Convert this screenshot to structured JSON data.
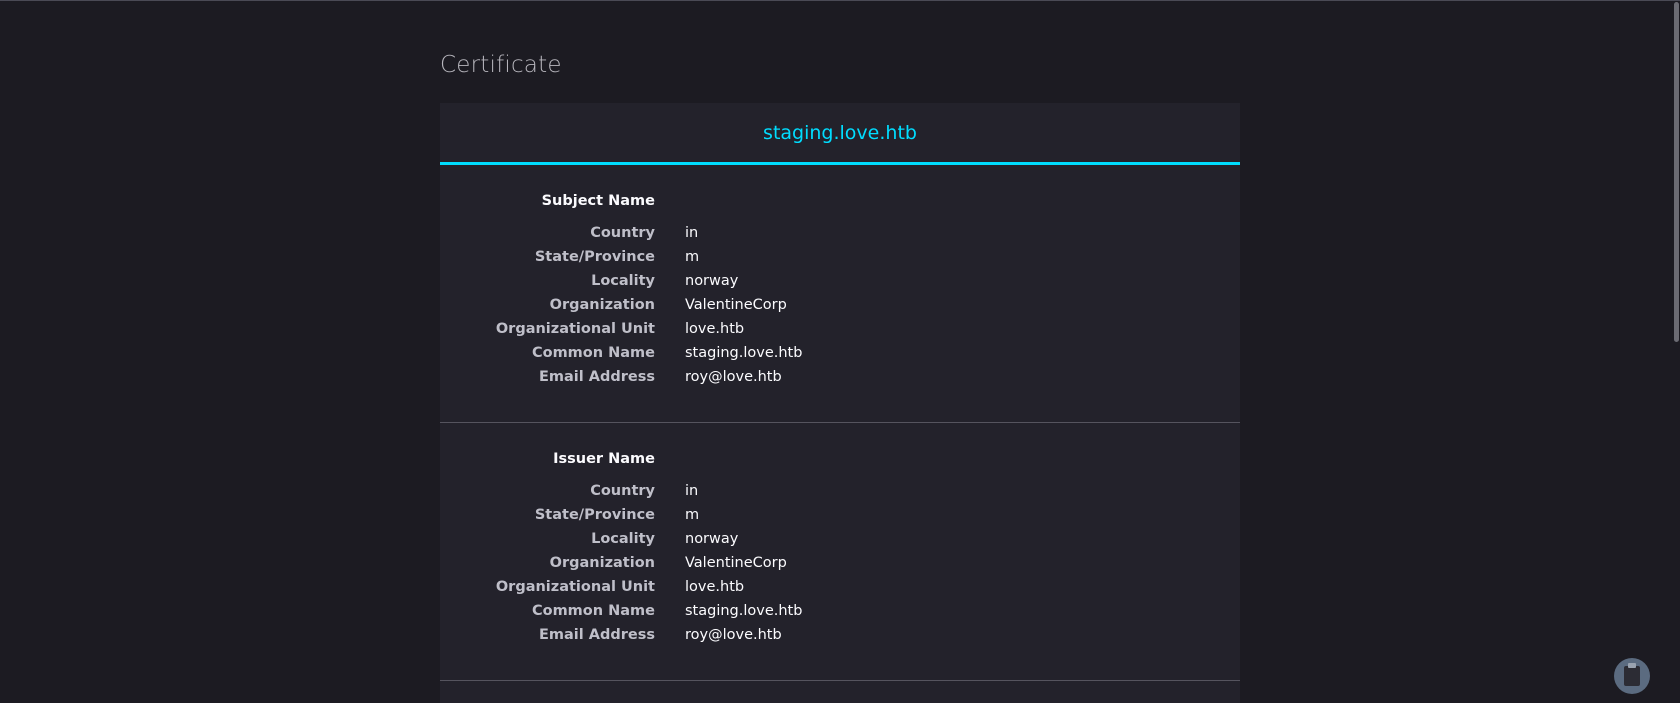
{
  "page": {
    "title": "Certificate"
  },
  "certificate": {
    "tab_title": "staging.love.htb",
    "subject": {
      "heading": "Subject Name",
      "fields": [
        {
          "label": "Country",
          "value": "in"
        },
        {
          "label": "State/Province",
          "value": "m"
        },
        {
          "label": "Locality",
          "value": "norway"
        },
        {
          "label": "Organization",
          "value": "ValentineCorp"
        },
        {
          "label": "Organizational Unit",
          "value": "love.htb"
        },
        {
          "label": "Common Name",
          "value": "staging.love.htb"
        },
        {
          "label": "Email Address",
          "value": "roy@love.htb"
        }
      ]
    },
    "issuer": {
      "heading": "Issuer Name",
      "fields": [
        {
          "label": "Country",
          "value": "in"
        },
        {
          "label": "State/Province",
          "value": "m"
        },
        {
          "label": "Locality",
          "value": "norway"
        },
        {
          "label": "Organization",
          "value": "ValentineCorp"
        },
        {
          "label": "Organizational Unit",
          "value": "love.htb"
        },
        {
          "label": "Common Name",
          "value": "staging.love.htb"
        },
        {
          "label": "Email Address",
          "value": "roy@love.htb"
        }
      ]
    }
  },
  "colors": {
    "background": "#1c1b22",
    "panel": "#23222b",
    "accent": "#00ddff",
    "label": "#bfbfc9",
    "value": "#fbfbfe"
  },
  "icons": {
    "floating_button": "clipboard-icon"
  }
}
